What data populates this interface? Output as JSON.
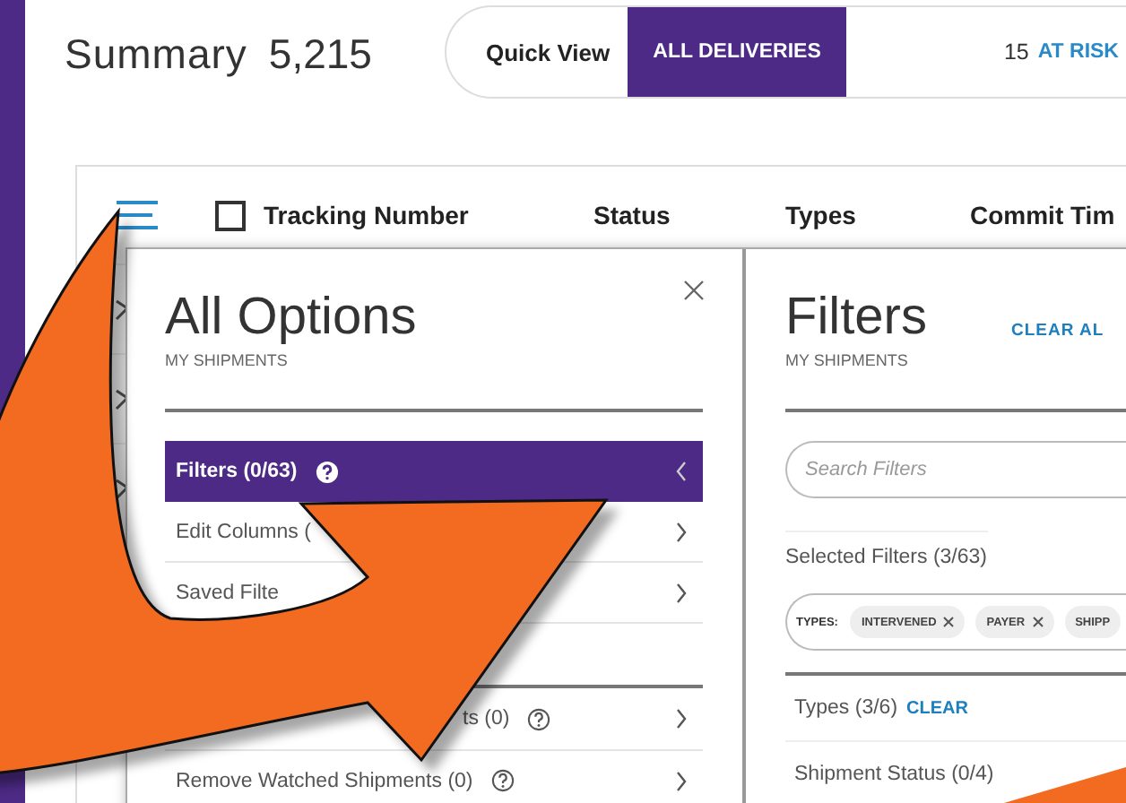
{
  "header": {
    "title": "Summary",
    "count": "5,215"
  },
  "quick_view": {
    "label": "Quick View",
    "options": [
      {
        "label": "ALL DELIVERIES",
        "selected": true
      },
      {
        "count": "15",
        "label": "AT RISK",
        "selected": false
      }
    ]
  },
  "table": {
    "select_all_checked": false,
    "columns": [
      "Tracking Number",
      "Status",
      "Types",
      "Commit Tim"
    ]
  },
  "options_panel": {
    "title": "All Options",
    "subtitle": "MY SHIPMENTS",
    "items": [
      {
        "label": "Filters (0/63)",
        "selected": true,
        "help": true
      },
      {
        "label": "Edit Columns (",
        "selected": false,
        "help": false
      },
      {
        "label": "Saved Filte",
        "selected": false,
        "help": false
      },
      {
        "label": "ts (0)",
        "selected": false,
        "help": true
      },
      {
        "label": "Remove Watched Shipments (0)",
        "selected": false,
        "help": true
      }
    ]
  },
  "filters_panel": {
    "title": "Filters",
    "subtitle": "MY SHIPMENTS",
    "clear_all": "CLEAR AL",
    "search": {
      "placeholder": "Search Filters"
    },
    "selected_label": "Selected Filters (3/63)",
    "chip_group": "TYPES:",
    "chips": [
      {
        "label": "INTERVENED",
        "removable": true
      },
      {
        "label": "PAYER",
        "removable": true
      },
      {
        "label": "SHIPP",
        "removable": false
      }
    ],
    "groups": [
      {
        "label": "Types (3/6)",
        "clear": "CLEAR"
      },
      {
        "label": "Shipment Status (0/4)"
      }
    ]
  }
}
